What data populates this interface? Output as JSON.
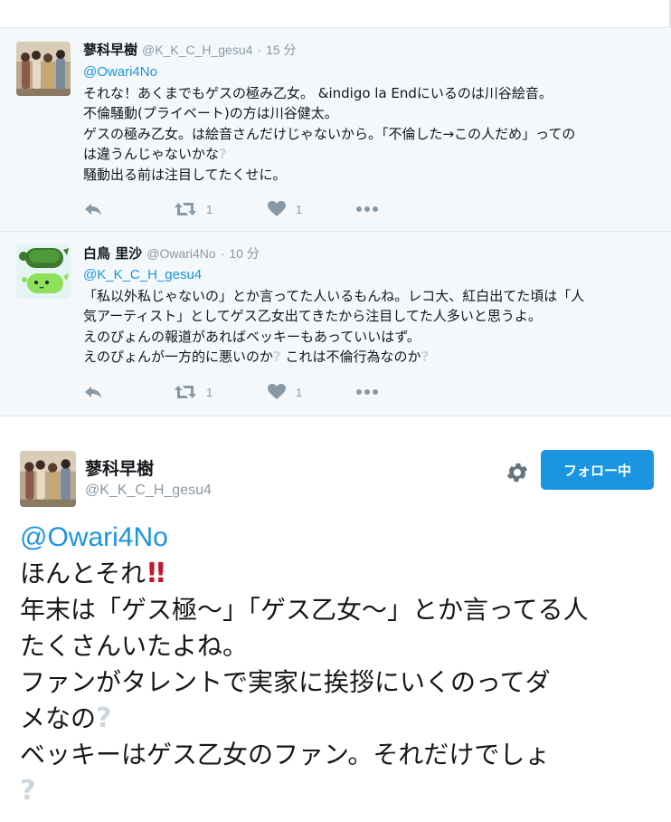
{
  "reply1": {
    "name": "蓼科早樹",
    "handle": "@K_K_C_H_gesu4",
    "time": "15 分",
    "mention": "@Owari4No",
    "lines": [
      "それな！あくまでもゲスの極み乙女。 &indigo la Endにいるのは川谷絵音。",
      "不倫騒動(プライベート)の方は川谷健太。",
      "ゲスの極み乙女。は絵音さんだけじゃないから。「不倫した→この人だめ」っての",
      "は違うんじゃないかな",
      "騒動出る前は注目してたくせに。"
    ],
    "retweet_count": "1",
    "like_count": "1"
  },
  "reply2": {
    "name": "白鳥 里沙",
    "handle": "@Owari4No",
    "time": "10 分",
    "mention": "@K_K_C_H_gesu4",
    "lines": [
      "「私以外私じゃないの」とか言ってた人いるもんね。レコ大、紅白出てた頃は「人",
      "気アーティスト」としてゲス乙女出てきたから注目してた人多いと思うよ。",
      "えのぴょんの報道があればベッキーもあっていいはず。",
      "えのぴょんが一方的に悪いのか",
      " これは不倫行為なのか"
    ],
    "retweet_count": "1",
    "like_count": "1"
  },
  "main": {
    "name": "蓼科早樹",
    "handle": "@K_K_C_H_gesu4",
    "follow_label": "フォロー中",
    "mention": "@Owari4No",
    "lines": [
      "ほんとそれ",
      "年末は「ゲス極～」「ゲス乙女～」とか言ってる人",
      "たくさんいたよね。",
      "ファンがタレントで実家に挨拶にいくのってダ",
      "メなの",
      "ベッキーはゲス乙女のファン。それだけでしょ"
    ]
  },
  "icons": [
    "reply-icon",
    "retweet-icon",
    "heart-icon",
    "more-icon",
    "gear-icon",
    "question-mark-emoji",
    "double-exclamation-emoji"
  ],
  "colors": {
    "link": "#1b95e0",
    "muted": "#8899a6",
    "follow_button": "#1b95e0",
    "exclaim": "#be1931",
    "reply_bg": "#f5f8fa"
  }
}
